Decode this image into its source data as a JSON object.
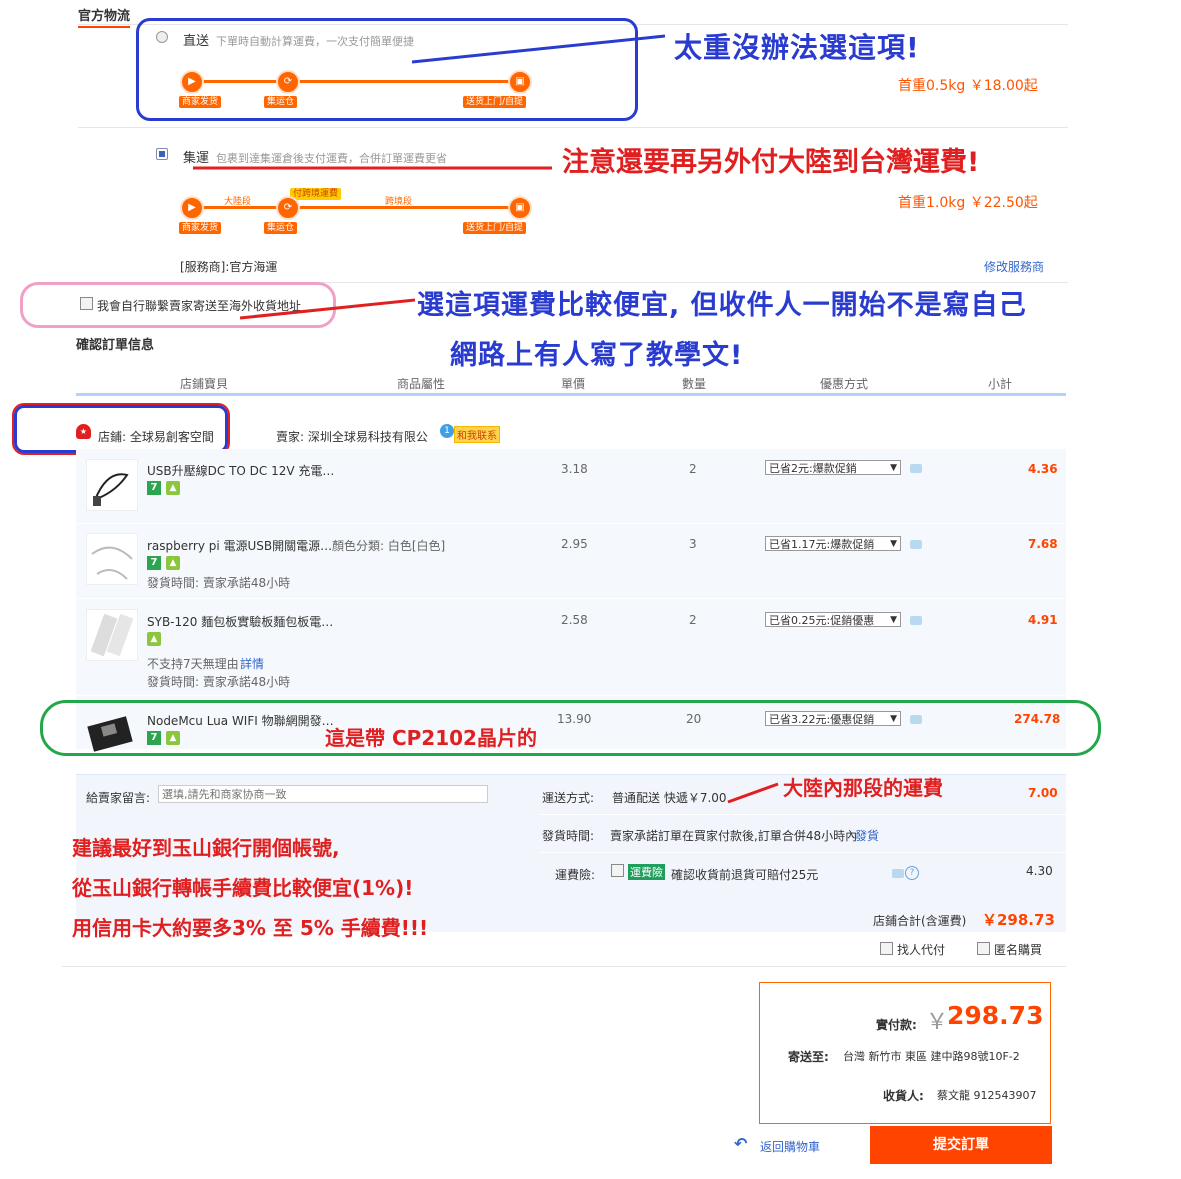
{
  "logistics": {
    "title": "官方物流",
    "direct": {
      "name": "直送",
      "desc": "下單時自動計算運費，一次支付簡單便捷",
      "price": "首重0.5kg ￥18.00起",
      "steps": [
        "商家发货",
        "集运仓",
        "送货上门/自提"
      ]
    },
    "consolidated": {
      "name": "集運",
      "desc": "包裹到達集運倉後支付運費，合併訂單運費更省",
      "price": "首重1.0kg ￥22.50起",
      "steps": [
        "商家发货",
        "集运仓",
        "送货上门/自提"
      ],
      "segments": [
        "大陸段",
        "付跨境運費",
        "跨境段"
      ],
      "provider": "[服務商]:官方海運",
      "modify": "修改服務商"
    },
    "self_ship": "我會自行聯繫賣家寄送至海外收貨地址"
  },
  "confirm": {
    "title": "確認訂單信息",
    "headers": [
      "店鋪寶貝",
      "商品屬性",
      "單價",
      "數量",
      "優惠方式",
      "小計"
    ],
    "shop_label": "店鋪: 全球易創客空間",
    "seller": "賣家: 深圳全球易科技有限公",
    "contact": "和我联系",
    "items": [
      {
        "name": "USB升壓線DC TO DC 12V 充電…",
        "attr": "",
        "price": "3.18",
        "qty": "2",
        "promo": "已省2元:爆款促銷",
        "subtotal": "4.36",
        "extra1": "",
        "extra2": ""
      },
      {
        "name": "raspberry pi 電源USB開關電源…",
        "attr": "顏色分類: 白色[白色]",
        "price": "2.95",
        "qty": "3",
        "promo": "已省1.17元:爆款促銷",
        "subtotal": "7.68",
        "extra1": "發貨時間: 賣家承諾48小時",
        "extra2": ""
      },
      {
        "name": "SYB-120 麵包板實驗板麵包板電…",
        "attr": "",
        "price": "2.58",
        "qty": "2",
        "promo": "已省0.25元:促銷優惠",
        "subtotal": "4.91",
        "extra1": "不支持7天無理由",
        "extra1_link": "詳情",
        "extra2": "發貨時間: 賣家承諾48小時"
      },
      {
        "name": "NodeMcu Lua WIFI 物聯網開發…",
        "attr": "",
        "price": "13.90",
        "qty": "20",
        "promo": "已省3.22元:優惠促銷",
        "subtotal": "274.78",
        "extra1": "",
        "extra2": ""
      }
    ],
    "note_label": "給賣家留言:",
    "note_placeholder": "選填,請先和商家协商一致",
    "ship_label": "運送方式:",
    "ship_value": "普通配送 快遞￥7.00",
    "ship_cost": "7.00",
    "dispatch_label": "發貨時間:",
    "dispatch_value": "賣家承諾訂單在買家付款後,訂單合併48小時內",
    "dispatch_link": "發貨",
    "insurance_label": "運費險:",
    "insurance_badge": "運費險",
    "insurance_text": "確認收貨前退貨可賠付25元",
    "insurance_cost": "4.30",
    "shop_total_label": "店鋪合計(含運費)",
    "shop_total": "￥298.73",
    "proxy_pay": "找人代付",
    "anonymous": "匿名購買"
  },
  "summary": {
    "pay_label": "實付款:",
    "currency": "￥",
    "amount": "298.73",
    "ship_to_label": "寄送至:",
    "ship_to": "台灣 新竹市 東區 建中路98號10F-2",
    "receiver_label": "收貨人:",
    "receiver": "蔡文龍 912543907",
    "back_link": "返回購物車",
    "submit": "提交訂單"
  },
  "annotations": {
    "too_heavy": "太重沒辦法選這項!",
    "extra_fee": "注意還要再另外付大陸到台灣運費!",
    "cheaper_line1": "選這項運費比較便宜, 但收件人一開始不是寫自己",
    "cheaper_line2": "網路上有人寫了教學文!",
    "cp2102": "這是帶 CP2102晶片的",
    "mainland_fee": "大陸內那段的運費",
    "advice1": "建議最好到玉山銀行開個帳號,",
    "advice2": "從玉山銀行轉帳手續費比較便宜(1%)!",
    "advice3": "用信用卡大約要多3% 至 5% 手續費!!!"
  }
}
